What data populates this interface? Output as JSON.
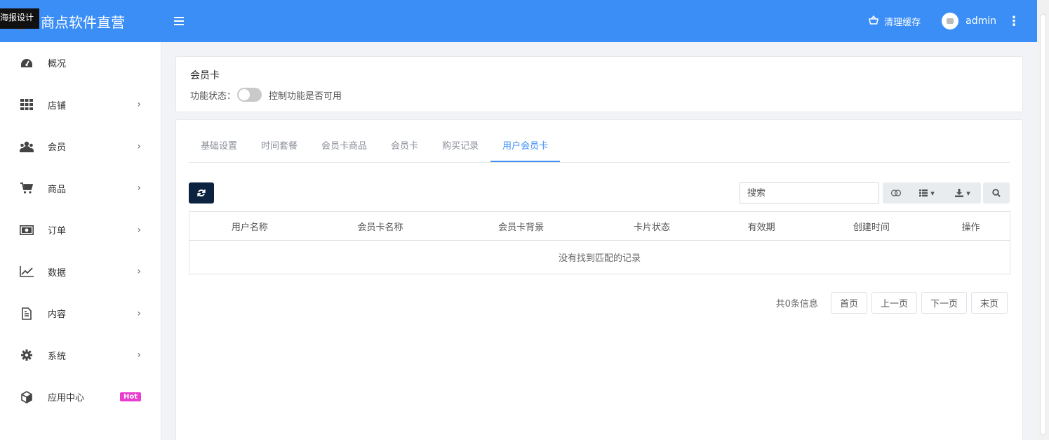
{
  "header": {
    "brand": "商点软件直营",
    "tooltip": "海报设计",
    "clear_cache": "清理缓存",
    "user": "admin"
  },
  "sidebar": {
    "items": [
      {
        "label": "概况",
        "icon": "dashboard-icon",
        "chevron": false
      },
      {
        "label": "店铺",
        "icon": "grid-icon",
        "chevron": true
      },
      {
        "label": "会员",
        "icon": "users-icon",
        "chevron": true
      },
      {
        "label": "商品",
        "icon": "cart-icon",
        "chevron": true
      },
      {
        "label": "订单",
        "icon": "money-icon",
        "chevron": true
      },
      {
        "label": "数据",
        "icon": "chart-icon",
        "chevron": true
      },
      {
        "label": "内容",
        "icon": "file-icon",
        "chevron": true
      },
      {
        "label": "系统",
        "icon": "gear-icon",
        "chevron": true
      },
      {
        "label": "应用中心",
        "icon": "cube-icon",
        "badge": "Hot"
      }
    ]
  },
  "card": {
    "title": "会员卡",
    "status_label": "功能状态：",
    "status_desc": "控制功能是否可用",
    "enabled": false
  },
  "tabs": [
    "基础设置",
    "时间套餐",
    "会员卡商品",
    "会员卡",
    "购买记录",
    "用户会员卡"
  ],
  "active_tab": "用户会员卡",
  "search": {
    "placeholder": "搜索"
  },
  "table": {
    "columns": [
      "用户名称",
      "会员卡名称",
      "会员卡背景",
      "卡片状态",
      "有效期",
      "创建时间",
      "操作"
    ],
    "empty": "没有找到匹配的记录"
  },
  "pager": {
    "info": "共0条信息",
    "first": "首页",
    "prev": "上一页",
    "next": "下一页",
    "last": "末页"
  },
  "colors": {
    "primary": "#3a8ef6",
    "dark_button": "#0c2340",
    "hot_badge": "#e83ecf"
  }
}
